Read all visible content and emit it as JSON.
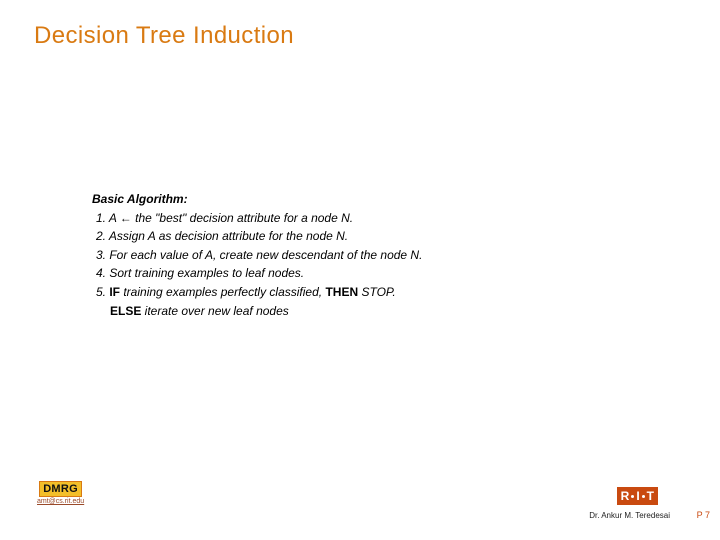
{
  "slide": {
    "title": "Decision Tree Induction"
  },
  "algorithm": {
    "heading": "Basic Algorithm:",
    "step1_prefix": "1. A ",
    "step1_arrow": "←",
    "step1_suffix": " the \"best\" decision attribute for a node N.",
    "step2": "2. Assign A as decision attribute for the node N.",
    "step3": "3. For each value of A, create new descendant of the node N.",
    "step4": "4. Sort training examples to leaf nodes.",
    "step5_prefix": "5. ",
    "step5_if": "IF",
    "step5_mid": " training examples perfectly classified, ",
    "step5_then": "THEN",
    "step5_end": " STOP.",
    "step5_else": "ELSE",
    "step5_else_rest": " iterate over new leaf nodes"
  },
  "footer": {
    "badge": "DMRG",
    "badge_link": "amt@cs.rit.edu",
    "logo_r": "R",
    "logo_i": "I",
    "logo_t": "T",
    "author": "Dr. Ankur M. Teredesai",
    "page": "P 7"
  }
}
